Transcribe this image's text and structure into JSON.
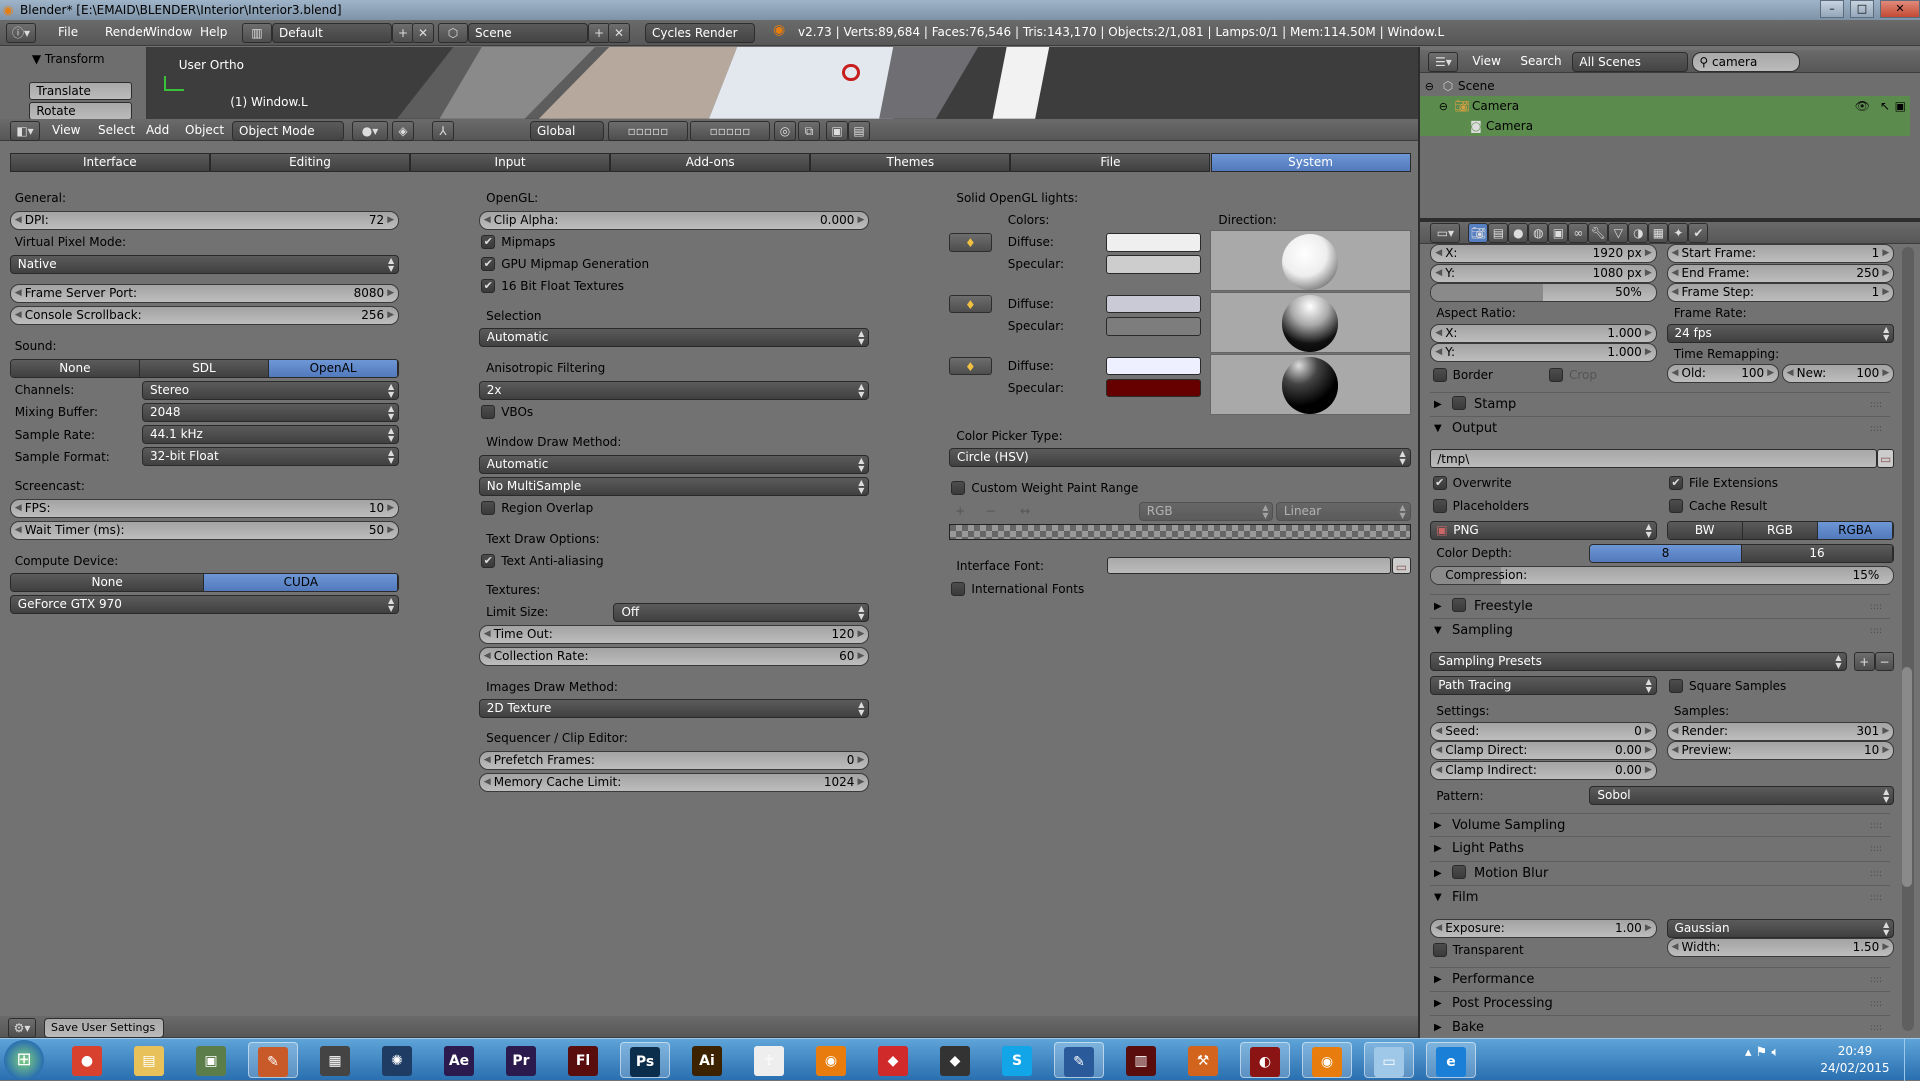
{
  "window": {
    "title": "Blender* [E:\\EMAID\\BLENDER\\Interior\\Interior3.blend]",
    "controls": [
      "minimize",
      "maximize",
      "close"
    ]
  },
  "info_header": {
    "menus": [
      "File",
      "Render",
      "Window",
      "Help"
    ],
    "layout": "Default",
    "scene": "Scene",
    "engine": "Cycles Render",
    "stats": "v2.73 | Verts:89,684 | Faces:76,546 | Tris:143,170 | Objects:2/1,081 | Lamps:0/1 | Mem:114.50M | Window.L"
  },
  "viewport": {
    "view_name": "User Ortho",
    "object_name": "(1) Window.L",
    "toolshelf": {
      "panel": "Transform",
      "buttons": [
        "Translate",
        "Rotate"
      ]
    }
  },
  "viewport_header": {
    "menus": [
      "View",
      "Select",
      "Add",
      "Object"
    ],
    "mode": "Object Mode",
    "orientation": "Global"
  },
  "prefs": {
    "tabs": [
      "Interface",
      "Editing",
      "Input",
      "Add-ons",
      "Themes",
      "File",
      "System"
    ],
    "active_tab": 6,
    "accent": "#5680c2",
    "col1": {
      "general": "General:",
      "dpi": {
        "label": "DPI:",
        "value": "72"
      },
      "virtual_pixel_mode": {
        "label": "Virtual Pixel Mode:",
        "value": "Native"
      },
      "frame_server_port": {
        "label": "Frame Server Port:",
        "value": "8080"
      },
      "console_scrollback": {
        "label": "Console Scrollback:",
        "value": "256"
      },
      "sound": {
        "label": "Sound:",
        "options": [
          "None",
          "SDL",
          "OpenAL"
        ],
        "selected": 2
      },
      "channels": {
        "label": "Channels:",
        "value": "Stereo"
      },
      "mixing_buffer": {
        "label": "Mixing Buffer:",
        "value": "2048"
      },
      "sample_rate": {
        "label": "Sample Rate:",
        "value": "44.1 kHz"
      },
      "sample_format": {
        "label": "Sample Format:",
        "value": "32-bit Float"
      },
      "screencast": "Screencast:",
      "fps": {
        "label": "FPS:",
        "value": "10"
      },
      "wait_timer": {
        "label": "Wait Timer (ms):",
        "value": "50"
      },
      "compute_device": {
        "label": "Compute Device:",
        "options": [
          "None",
          "CUDA"
        ],
        "selected": 1
      },
      "gpu": {
        "value": "GeForce GTX 970"
      }
    },
    "col2": {
      "opengl": "OpenGL:",
      "clip_alpha": {
        "label": "Clip Alpha:",
        "value": "0.000"
      },
      "mipmaps": {
        "label": "Mipmaps",
        "checked": true
      },
      "gpu_mipmap": {
        "label": "GPU Mipmap Generation",
        "checked": true
      },
      "float_textures": {
        "label": "16 Bit Float Textures",
        "checked": true
      },
      "selection": {
        "label": "Selection",
        "value": "Automatic"
      },
      "anisotropic": {
        "label": "Anisotropic Filtering",
        "value": "2x"
      },
      "vbos": {
        "label": "VBOs",
        "checked": false
      },
      "window_draw": {
        "label": "Window Draw Method:",
        "value": "Automatic",
        "multisample": "No MultiSample"
      },
      "region_overlap": {
        "label": "Region Overlap",
        "checked": false
      },
      "text_draw": "Text Draw Options:",
      "text_aa": {
        "label": "Text Anti-aliasing",
        "checked": true
      },
      "textures": "Textures:",
      "limit_size": {
        "label": "Limit Size:",
        "value": "Off"
      },
      "time_out": {
        "label": "Time Out:",
        "value": "120"
      },
      "collection_rate": {
        "label": "Collection Rate:",
        "value": "60"
      },
      "images_draw": {
        "label": "Images Draw Method:",
        "value": "2D Texture"
      },
      "sequencer": "Sequencer / Clip Editor:",
      "prefetch": {
        "label": "Prefetch Frames:",
        "value": "0"
      },
      "memory_cache": {
        "label": "Memory Cache Limit:",
        "value": "1024"
      }
    },
    "col3": {
      "solid_lights": "Solid OpenGL lights:",
      "colors": "Colors:",
      "direction": "Direction:",
      "diffuse_label": "Diffuse:",
      "specular_label": "Specular:",
      "lights": [
        {
          "diffuse": "#efefef",
          "specular": "#cdcdcd",
          "icon": "light-bulb-icon"
        },
        {
          "diffuse": "#c9cad6",
          "specular": "#7d7d7d",
          "icon": "light-bulb-icon"
        },
        {
          "diffuse": "#eef0ff",
          "specular": "#660000",
          "icon": "light-bulb-icon"
        }
      ],
      "color_picker": {
        "label": "Color Picker Type:",
        "value": "Circle (HSV)"
      },
      "weight_range": {
        "label": "Custom Weight Paint Range",
        "checked": false
      },
      "ramp_mode": "RGB",
      "ramp_interp": "Linear",
      "interface_font": {
        "label": "Interface Font:",
        "value": ""
      },
      "intl_fonts": {
        "label": "International Fonts",
        "checked": false
      }
    },
    "save_button": "Save User Settings"
  },
  "outliner": {
    "menus": [
      "View",
      "Search"
    ],
    "filter": "All Scenes",
    "search": "camera",
    "rows": [
      {
        "label": "Scene",
        "icon": "scene-icon"
      },
      {
        "label": "Camera",
        "icon": "camera-object-icon"
      },
      {
        "label": "Camera",
        "icon": "camera-data-icon"
      }
    ]
  },
  "properties": {
    "tabs": [
      "render",
      "render-layers",
      "scene",
      "world",
      "object",
      "constraints",
      "modifiers",
      "data",
      "material",
      "texture",
      "particles",
      "physics"
    ],
    "res_x": {
      "label": "X:",
      "value": "1920 px"
    },
    "res_y": {
      "label": "Y:",
      "value": "1080 px"
    },
    "res_pct": {
      "label": "",
      "value": "50%",
      "fill": 0.5
    },
    "start_frame": {
      "label": "Start Frame:",
      "value": "1"
    },
    "end_frame": {
      "label": "End Frame:",
      "value": "250"
    },
    "frame_step": {
      "label": "Frame Step:",
      "value": "1"
    },
    "aspect_label": "Aspect Ratio:",
    "aspect_x": {
      "label": "X:",
      "value": "1.000"
    },
    "aspect_y": {
      "label": "Y:",
      "value": "1.000"
    },
    "frame_rate": {
      "label": "Frame Rate:",
      "value": "24 fps"
    },
    "time_remap": "Time Remapping:",
    "old": {
      "label": "Old:",
      "value": "100"
    },
    "new": {
      "label": "New:",
      "value": "100"
    },
    "border": {
      "label": "Border",
      "checked": false
    },
    "crop": {
      "label": "Crop",
      "checked": false
    },
    "stamp": {
      "title": "Stamp",
      "open": false,
      "checkbox": true
    },
    "output": {
      "title": "Output",
      "open": true,
      "checkbox": false
    },
    "output_path": "/tmp\\",
    "overwrite": {
      "label": "Overwrite",
      "checked": true
    },
    "file_ext": {
      "label": "File Extensions",
      "checked": true
    },
    "placeholders": {
      "label": "Placeholders",
      "checked": false
    },
    "cache_result": {
      "label": "Cache Result",
      "checked": false
    },
    "format": "PNG",
    "color_mode": {
      "options": [
        "BW",
        "RGB",
        "RGBA"
      ],
      "selected": 2
    },
    "color_depth": {
      "label": "Color Depth:",
      "options": [
        "8",
        "16"
      ],
      "selected": 0
    },
    "compression": {
      "label": "Compression:",
      "value": "15%",
      "fill": 0.15
    },
    "freestyle": {
      "title": "Freestyle",
      "open": false,
      "checkbox": true
    },
    "sampling": {
      "title": "Sampling",
      "open": true,
      "checkbox": false
    },
    "sampling_presets": "Sampling Presets",
    "integrator": "Path Tracing",
    "square_samples": {
      "label": "Square Samples",
      "checked": false
    },
    "settings_label": "Settings:",
    "samples_label": "Samples:",
    "seed": {
      "label": "Seed:",
      "value": "0"
    },
    "clamp_direct": {
      "label": "Clamp Direct:",
      "value": "0.00"
    },
    "clamp_indirect": {
      "label": "Clamp Indirect:",
      "value": "0.00"
    },
    "render_samples": {
      "label": "Render:",
      "value": "301"
    },
    "preview_samples": {
      "label": "Preview:",
      "value": "10"
    },
    "pattern": {
      "label": "Pattern:",
      "value": "Sobol"
    },
    "volume_sampling": {
      "title": "Volume Sampling",
      "open": false,
      "checkbox": false
    },
    "light_paths": {
      "title": "Light Paths",
      "open": false,
      "checkbox": false
    },
    "motion_blur": {
      "title": "Motion Blur",
      "open": false,
      "checkbox": true
    },
    "film": {
      "title": "Film",
      "open": true,
      "checkbox": false
    },
    "exposure": {
      "label": "Exposure:",
      "value": "1.00"
    },
    "filter": "Gaussian",
    "filter_width": {
      "label": "Width:",
      "value": "1.50"
    },
    "transparent": {
      "label": "Transparent",
      "checked": false
    },
    "performance": {
      "title": "Performance",
      "open": false,
      "checkbox": false
    },
    "post_processing": {
      "title": "Post Processing",
      "open": false,
      "checkbox": false
    },
    "bake": {
      "title": "Bake",
      "open": false,
      "checkbox": false
    }
  },
  "taskbar": {
    "apps": [
      {
        "name": "chrome",
        "glyph": "●",
        "color": "#d9412f"
      },
      {
        "name": "explorer",
        "glyph": "▤",
        "color": "#e8c15a"
      },
      {
        "name": "monitor-app",
        "glyph": "▣",
        "color": "#5a7d4a"
      },
      {
        "name": "paint-app",
        "glyph": "✎",
        "color": "#c85a2a",
        "open": true
      },
      {
        "name": "display-app",
        "glyph": "▦",
        "color": "#444"
      },
      {
        "name": "cinema4d",
        "glyph": "✺",
        "color": "#1e3c64"
      },
      {
        "name": "after-effects",
        "glyph": "Ae",
        "color": "#2b1a4d"
      },
      {
        "name": "premiere",
        "glyph": "Pr",
        "color": "#2b1a4d"
      },
      {
        "name": "flash",
        "glyph": "Fl",
        "color": "#5a0d0d"
      },
      {
        "name": "photoshop",
        "glyph": "Ps",
        "color": "#0c2e4d",
        "open": true
      },
      {
        "name": "illustrator",
        "glyph": "Ai",
        "color": "#3d2200"
      },
      {
        "name": "zbrush",
        "glyph": "☥",
        "color": "#eeeeee"
      },
      {
        "name": "blender",
        "glyph": "◉",
        "color": "#e87d0d"
      },
      {
        "name": "sketchup",
        "glyph": "◆",
        "color": "#d12a2a"
      },
      {
        "name": "tablet-app",
        "glyph": "◆",
        "color": "#333"
      },
      {
        "name": "skype",
        "glyph": "S",
        "color": "#12a5e8"
      },
      {
        "name": "editor-app",
        "glyph": "✎",
        "color": "#2b5a9a",
        "open": true
      },
      {
        "name": "video-app",
        "glyph": "▥",
        "color": "#5a0d0d"
      },
      {
        "name": "tools-app",
        "glyph": "⚒",
        "color": "#d2641e"
      },
      {
        "name": "gpu-monitor",
        "glyph": "◐",
        "color": "#8a1414",
        "open": true
      },
      {
        "name": "blender",
        "glyph": "◉",
        "color": "#e87d0d",
        "open": true
      },
      {
        "name": "notepad",
        "glyph": "▭",
        "color": "#9fc8e8",
        "open": true
      },
      {
        "name": "internet-explorer",
        "glyph": "e",
        "color": "#1a7fd6",
        "open": true
      }
    ],
    "time": "20:49",
    "date": "24/02/2015"
  }
}
